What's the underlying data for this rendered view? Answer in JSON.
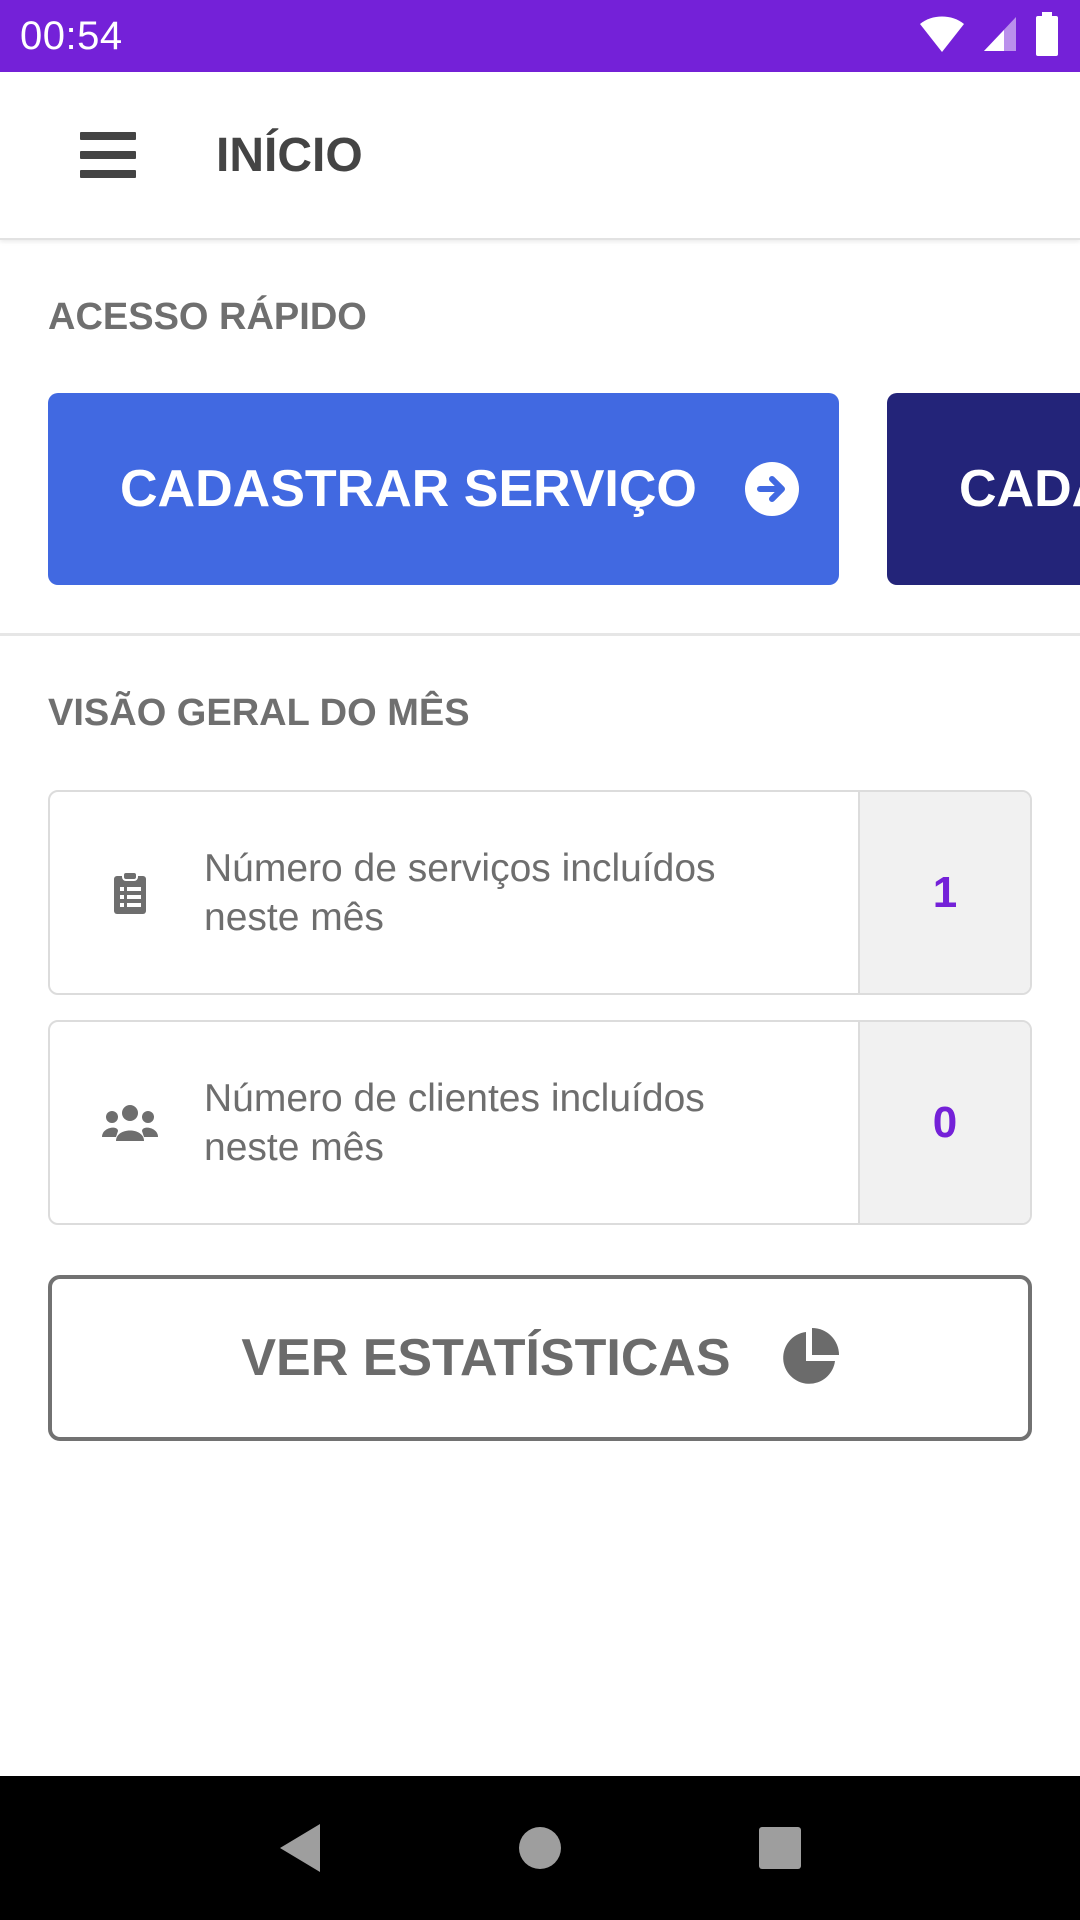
{
  "status_bar": {
    "time": "00:54",
    "icons": [
      "wifi-icon",
      "cellular-signal-icon",
      "battery-icon"
    ],
    "color": "#7421D8"
  },
  "app_bar": {
    "title": "INÍCIO",
    "menu_icon": "hamburger-menu-icon"
  },
  "quick_access": {
    "title": "ACESSO RÁPIDO",
    "buttons": [
      {
        "label": "CADASTRAR SERVIÇO",
        "icon": "arrow-right-circle-icon",
        "color": "#4169E1"
      },
      {
        "label": "CADA",
        "color": "#232479"
      }
    ]
  },
  "overview": {
    "title": "VISÃO GERAL DO MÊS",
    "cards": [
      {
        "icon": "clipboard-list-icon",
        "label": "Número de serviços incluídos neste mês",
        "value": "1"
      },
      {
        "icon": "users-icon",
        "label": "Número de clientes incluídos neste mês",
        "value": "0"
      }
    ],
    "value_color": "#7421D8"
  },
  "stats_button": {
    "label": "VER ESTATÍSTICAS",
    "icon": "pie-chart-icon"
  },
  "nav_bar": {
    "icons": [
      "back-icon",
      "home-icon",
      "recents-icon"
    ]
  }
}
